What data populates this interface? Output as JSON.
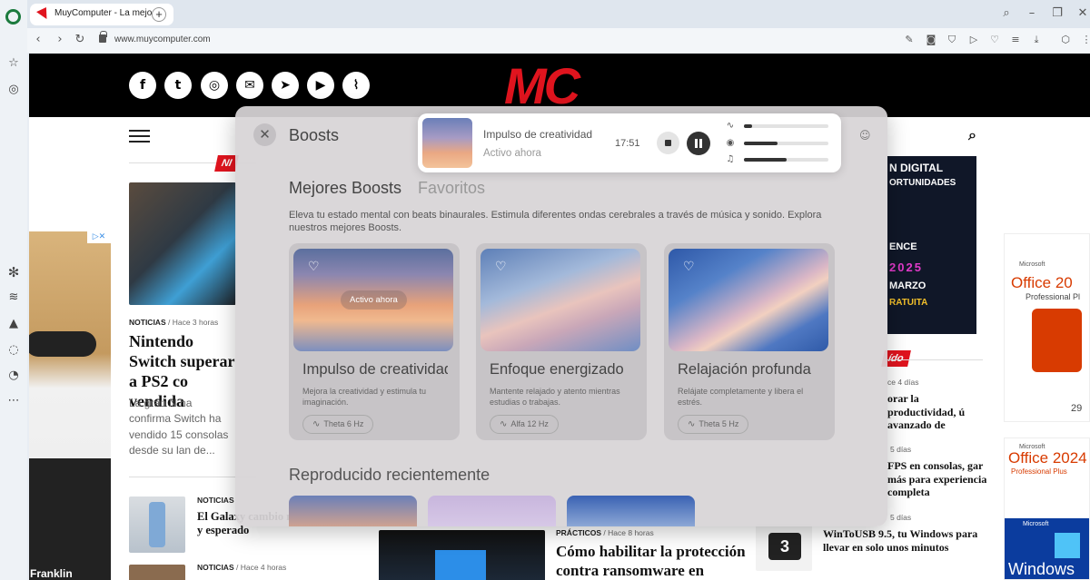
{
  "browser": {
    "tab_title": "MuyComputer - La mejo",
    "url": "www.muycomputer.com",
    "new_tab": "+"
  },
  "site": {
    "logo": "MC",
    "hot_tag": "NI",
    "featured": {
      "category": "NOTICIAS",
      "time": "Hace 3 horas",
      "headline": "Nintendo Switch superar a PS2 co vendida",
      "excerpt": "La gran N ha confirma Switch ha vendido 15 consolas desde su lan de..."
    },
    "small_news": [
      {
        "category": "NOTICIAS",
        "time": "",
        "headline": "El Galaxy cambio muy importante y esperado"
      },
      {
        "category": "NOTICIAS",
        "time": "Hace 4 horas",
        "headline": ""
      }
    ],
    "bottom_news": {
      "category": "PRÁCTICOS",
      "time": "Hace 8 horas",
      "headline": "Cómo habilitar la protección contra ransomware en"
    },
    "right_news": [
      {
        "time": "ce 4 días",
        "headline": "orar la productividad, ú avanzado de"
      },
      {
        "time": "5 días",
        "headline": "FPS en consolas, gar más para experiencia completa"
      },
      {
        "time": "5 días",
        "headline": "WinToUSB 9.5, tu Windows para llevar en solo unos minutos"
      }
    ],
    "right_tag": "ído",
    "ad_banner": {
      "line1": "N DIGITAL",
      "line2": "ORTUNIDADES",
      "line3": "ENCE",
      "line4": "2025",
      "line5": "MARZO",
      "line6": "RATUITA"
    },
    "office_ads": [
      {
        "brand": "Microsoft",
        "title": "Office 20",
        "sub": "Professional Pl",
        "price": "29"
      },
      {
        "brand": "Microsoft",
        "title": "Office 2024",
        "sub": "Professional Plus",
        "price": ""
      },
      {
        "brand": "Microsoft",
        "title": "Windows",
        "sub": "",
        "price": ""
      }
    ],
    "left_ad_text": "Franklin"
  },
  "boosts": {
    "title": "Boosts",
    "tabs": [
      "Mejores Boosts",
      "Favoritos"
    ],
    "description": "Eleva tu estado mental con beats binaurales. Estimula diferentes ondas cerebrales a través de música y sonido. Explora nuestros mejores Boosts.",
    "cards": [
      {
        "title": "Impulso de creatividad",
        "desc": "Mejora la creatividad y estimula tu imaginación.",
        "wave": "Theta 6 Hz",
        "active_label": "Activo ahora"
      },
      {
        "title": "Enfoque energizado",
        "desc": "Mantente relajado y atento mientras estudias o trabajas.",
        "wave": "Alfa 12 Hz",
        "active_label": ""
      },
      {
        "title": "Relajación profunda",
        "desc": "Relájate completamente y libera el estrés.",
        "wave": "Theta 5 Hz",
        "active_label": ""
      }
    ],
    "recent_title": "Reproducido recientemente"
  },
  "player": {
    "title": "Impulso de creatividad",
    "subtitle": "Activo ahora",
    "time": "17:51",
    "levels": [
      0.1,
      0.4,
      0.5
    ]
  },
  "icons": {
    "close": "close-icon",
    "heart": "heart-icon",
    "wave": "wave-icon",
    "stop": "stop-icon",
    "pause": "pause-icon"
  },
  "colors": {
    "brand_red": "#e0141e",
    "opera_green": "#1b7a3d"
  }
}
